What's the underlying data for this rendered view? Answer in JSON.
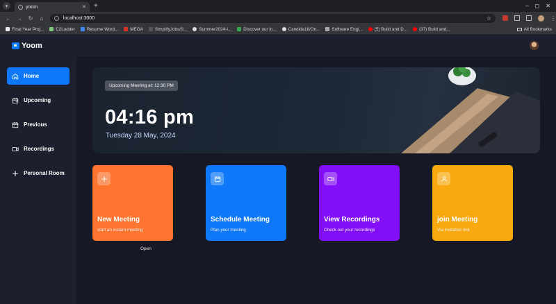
{
  "browser": {
    "tab_title": "yoom",
    "url": "localhost:3000",
    "bookmarks": [
      "Final Year Proj...",
      "C2Ladder",
      "Resume Word...",
      "MEGA",
      "SimplifyJobs/S...",
      "Summer2024-I...",
      "Discover our in...",
      "Candida18/On...",
      "Software Engi...",
      "(5) Build and D...",
      "(37) Build and..."
    ],
    "all_bookmarks": "All Bookmarks"
  },
  "app": {
    "logo": "Yoom"
  },
  "sidebar": {
    "items": [
      {
        "label": "Home",
        "icon": "home-icon"
      },
      {
        "label": "Upcoming",
        "icon": "calendar-upcoming-icon"
      },
      {
        "label": "Previous",
        "icon": "calendar-previous-icon"
      },
      {
        "label": "Recordings",
        "icon": "video-icon"
      },
      {
        "label": "Personal Room",
        "icon": "plus-icon"
      }
    ]
  },
  "hero": {
    "badge": "Upcoming Meeting at: 12:30 PM",
    "time": "04:16 pm",
    "date": "Tuesday 28 May, 2024"
  },
  "cards": [
    {
      "title": "New Meeting",
      "subtitle": "start an instant meeting",
      "icon": "plus-icon",
      "color": "#ff742e"
    },
    {
      "title": "Schedule Meeting",
      "subtitle": "Plan your meeting",
      "icon": "calendar-icon",
      "color": "#0e78f9"
    },
    {
      "title": "View Recordings",
      "subtitle": "Check out your recordings",
      "icon": "video-icon",
      "color": "#830ef9"
    },
    {
      "title": "join Meeting",
      "subtitle": "Via invitation link",
      "icon": "user-plus-icon",
      "color": "#f9a90e"
    }
  ],
  "open_label": "Open",
  "colors": {
    "accent_blue": "#0e78f9",
    "sidebar_bg": "#1c1f2e",
    "main_bg": "#161925"
  }
}
